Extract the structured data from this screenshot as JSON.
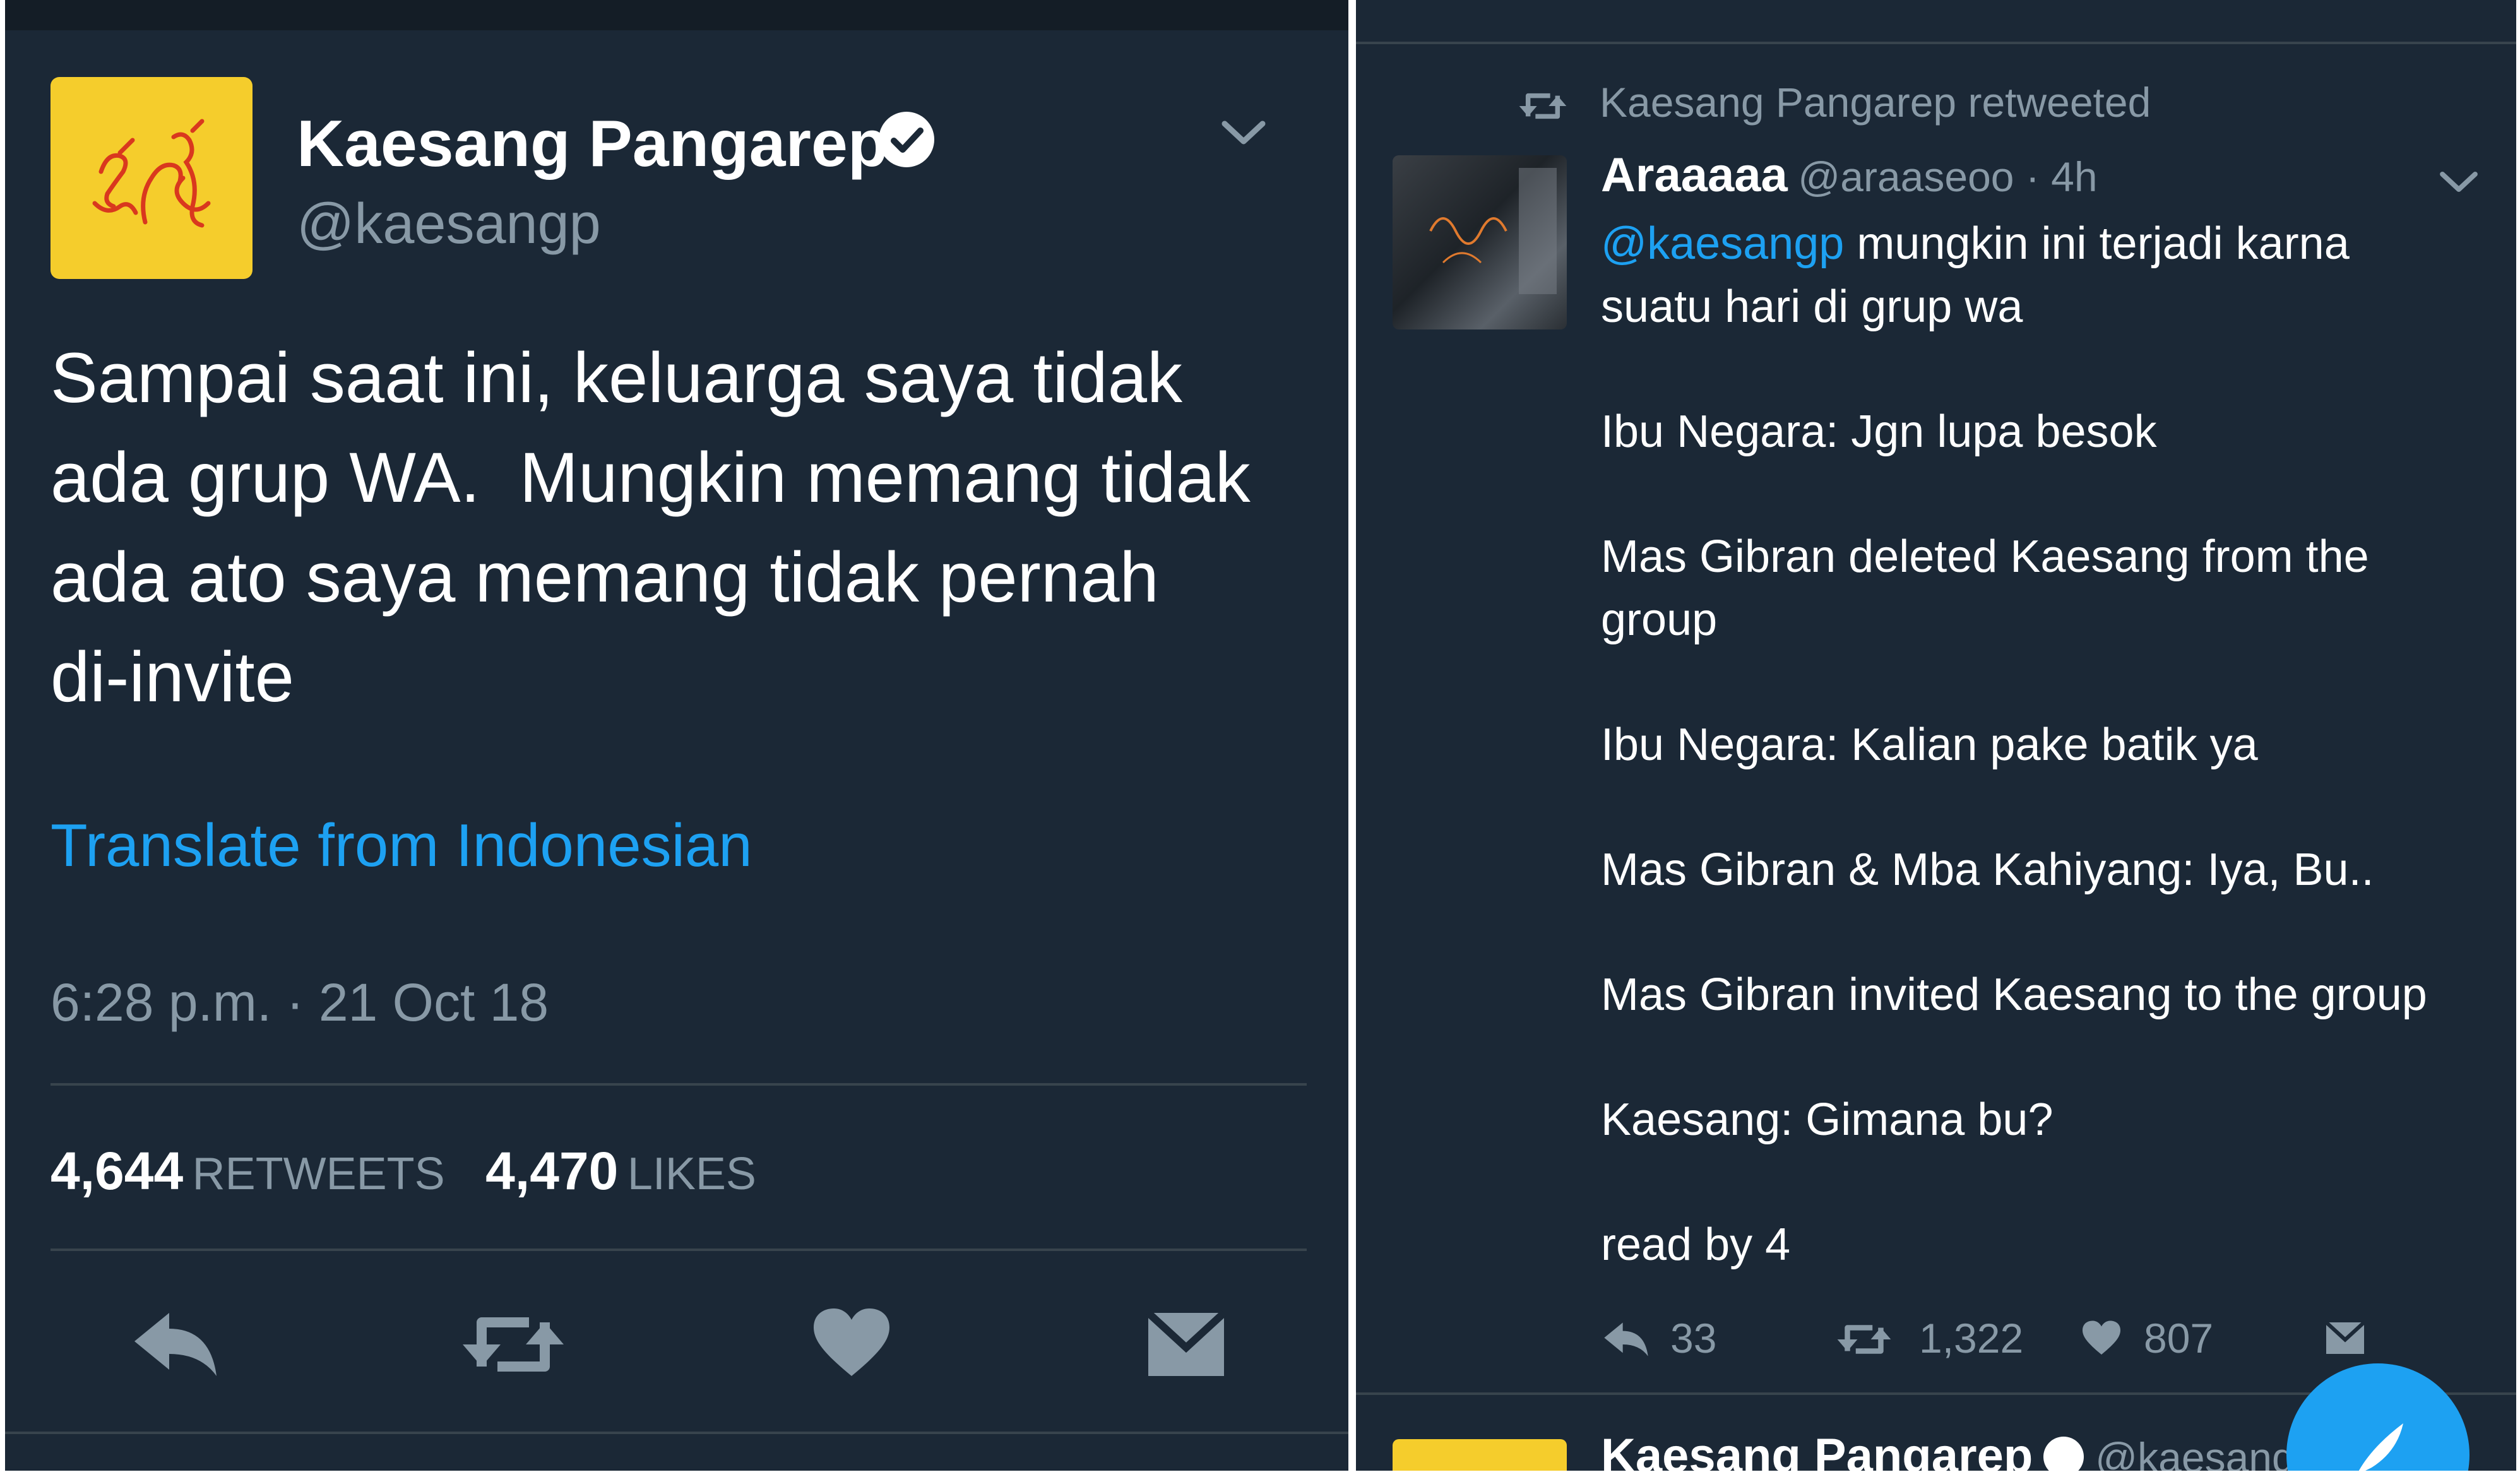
{
  "left_tweet": {
    "author_name": "Kaesang Pangarep",
    "handle": "@kaesangp",
    "text_lines": [
      "Sampai saat ini, keluarga saya tidak",
      "ada grup WA.  Mungkin memang tidak",
      "ada ato saya memang tidak pernah",
      "di-invite"
    ],
    "translate_label": "Translate from Indonesian",
    "timestamp": "6:28 p.m. · 21 Oct 18",
    "retweets_count": "4,644",
    "retweets_label": "RETWEETS",
    "likes_count": "4,470",
    "likes_label": "LIKES"
  },
  "right_tweet": {
    "retweeted_by": "Kaesang Pangarep retweeted",
    "author_name": "Araaaaa",
    "handle_time": "@araaseoo · 4h",
    "mention": "@kaesangp",
    "first_line_rest": " mungkin ini terjadi karna",
    "second_line": "suatu hari di grup wa",
    "paragraphs": [
      "Ibu Negara: Jgn lupa besok",
      "Mas Gibran deleted Kaesang from the",
      "group",
      "Ibu Negara: Kalian pake batik ya",
      "Mas Gibran & Mba Kahiyang: Iya, Bu..",
      "Mas Gibran invited Kaesang to the group",
      "Kaesang: Gimana bu?",
      "read by 4"
    ],
    "reply_count": "33",
    "retweet_count": "1,322",
    "like_count": "807"
  },
  "next_tweet": {
    "author_name": "Kaesang Pangarep",
    "handle": "@kaesangp"
  },
  "colors": {
    "background": "#1b2836",
    "accent": "#1da1f2",
    "secondary_text": "#8899a6",
    "avatar_yellow": "#f5cd2c"
  }
}
